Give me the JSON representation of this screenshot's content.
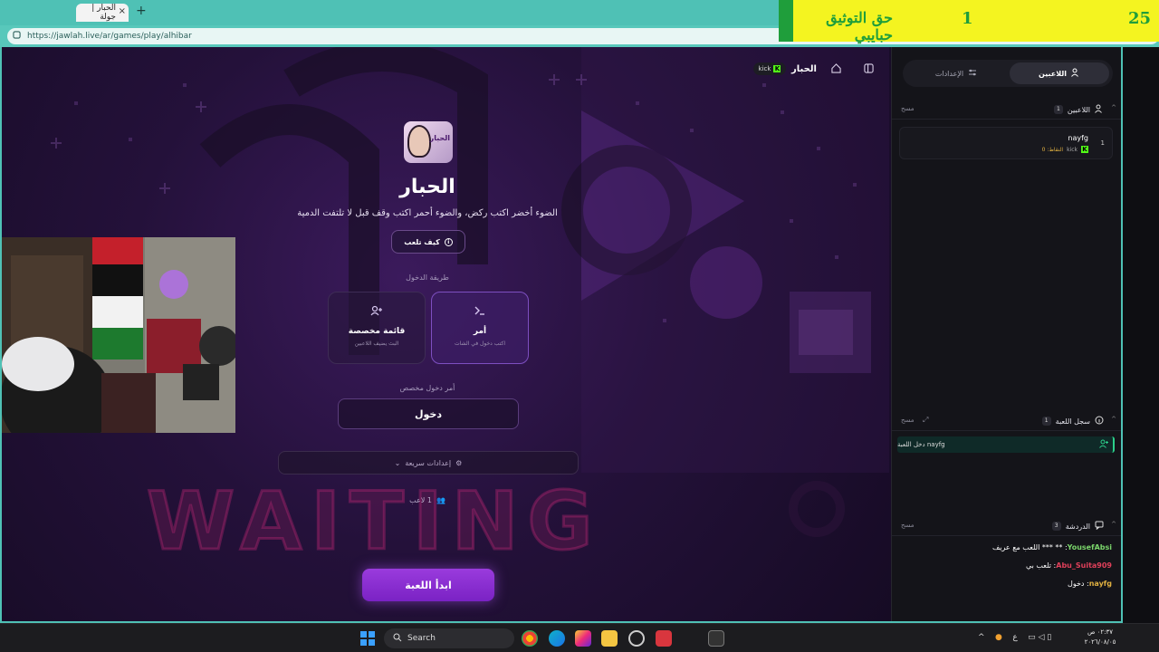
{
  "browser": {
    "tab_title": "الحبار | جولة",
    "tab_close": "×",
    "new_tab": "+",
    "url": "https://jawlah.live/ar/games/play/alhibar"
  },
  "overlay_banner": {
    "left_number": "25",
    "mid_number": "1",
    "right_text": "حق التوثيق حبايبي"
  },
  "game_nav": {
    "title": "الحبار",
    "kick_label": "kick",
    "kick_icon": "kick-logo-icon"
  },
  "game": {
    "logo_text": "الحبار",
    "title": "الحبار",
    "description": "الضوء أخضر اكتب ركض، والضوء أحمر اكتب وقف قبل لا تلتفت الدمية",
    "howto_label": "كيف تلعب",
    "entry_method_label": "طريقة الدخول",
    "cards": [
      {
        "title": "أمر",
        "subtitle": "اكتب دخول في الشات",
        "icon": "terminal-icon"
      },
      {
        "title": "قائمة مخصصة",
        "subtitle": "البث يضيف اللاعبين",
        "icon": "user-plus-icon"
      }
    ],
    "custom_command_label": "أمر دخول مخصص",
    "custom_command_value": "دخول",
    "quick_settings_label": "إعدادات سريعة",
    "players_count": "1 لاعب",
    "start_button": "ابدأ اللعبة",
    "background_text": "WAITING"
  },
  "sidebar": {
    "tabs": {
      "players": "اللاعبين",
      "settings": "الإعدادات"
    },
    "players_section": {
      "title": "اللاعبين",
      "count": "1",
      "clear": "مسح"
    },
    "players": [
      {
        "rank": "1",
        "name": "nayfg",
        "platform": "kick",
        "points": "النقاط: 0"
      }
    ],
    "log_section": {
      "title": "سجل اللعبة",
      "count": "1",
      "clear": "مسح"
    },
    "log_entries": [
      "nayfg دخل اللعبة"
    ],
    "chat_section": {
      "title": "الدردشة",
      "count": "3",
      "clear": "مسح"
    },
    "chat": [
      {
        "user": "YousefAbsi",
        "message": "** *** اللعب مع عريف",
        "color": "#7bd66b"
      },
      {
        "user": "Abu_Suita909",
        "message": "تلعب بي",
        "color": "#e0405a"
      },
      {
        "user": "nayfg",
        "message": "دخول",
        "color": "#e0b040"
      }
    ]
  },
  "taskbar": {
    "search_label": "Search",
    "time": "٠٢:٣٧ ص",
    "date": "٢٠٢٦/٠٨/٠٥",
    "lang": "ع"
  }
}
